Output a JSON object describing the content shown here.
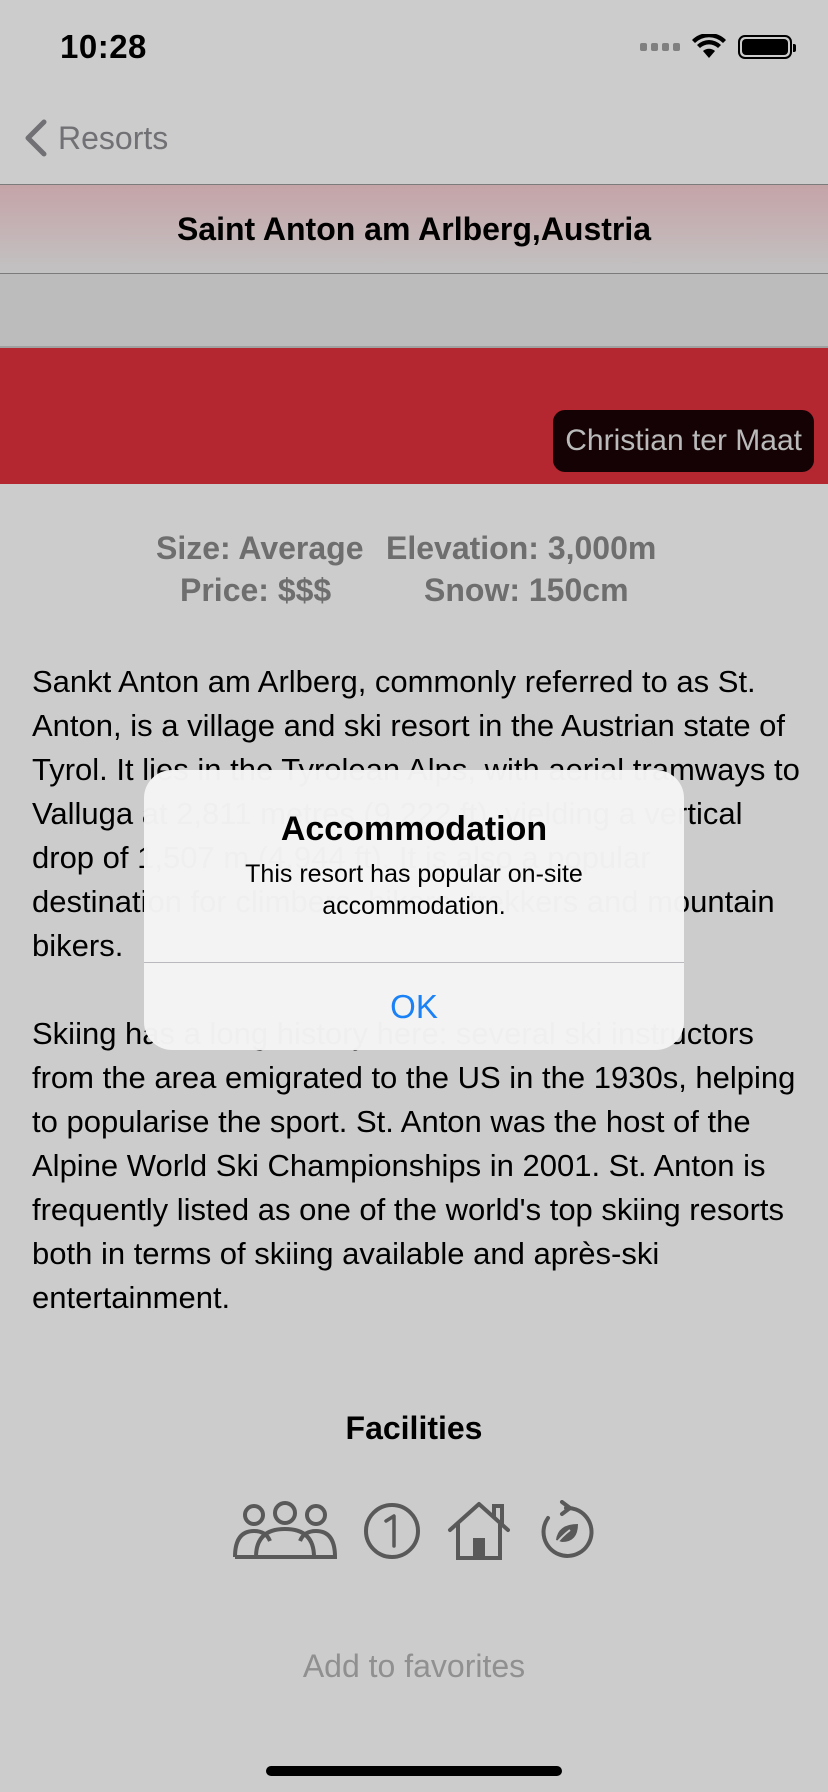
{
  "status_bar": {
    "time": "10:28"
  },
  "nav": {
    "back_label": "Resorts"
  },
  "resort": {
    "title": "Saint Anton am Arlberg,Austria",
    "photo_credit": "Christian ter Maat",
    "stats": {
      "size": "Size: Average",
      "elevation": "Elevation: 3,000m",
      "price": "Price: $$$",
      "snow": "Snow: 150cm"
    },
    "description": [
      "Sankt Anton am Arlberg, commonly referred to as St. Anton, is a village and ski resort in the Austrian state of Tyrol. It lies in the Tyrolean Alps, with aerial tramways to Valluga at 2,811 metres (9,222 ft), yielding a vertical drop of 1,507 m (4,944 ft). It is also a popular destination for climbers, hikers, trekkers and mountain bikers.",
      "Skiing has a long history here: several ski instructors from the area emigrated to the US in the 1930s, helping to popularise the sport. St. Anton was the host of the Alpine World Ski Championships in 2001. St. Anton is frequently listed as one of the world's top skiing resorts both in terms of skiing available and après-ski entertainment."
    ],
    "facilities_title": "Facilities",
    "facilities": [
      "people-icon",
      "number-one-icon",
      "house-icon",
      "eco-recycle-icon"
    ],
    "favorites_label": "Add to favorites"
  },
  "alert": {
    "title": "Accommodation",
    "message": "This resort has popular on-site accommodation.",
    "ok_label": "OK"
  },
  "colors": {
    "accent_red": "#e2313e",
    "link_blue": "#1a82f6"
  }
}
